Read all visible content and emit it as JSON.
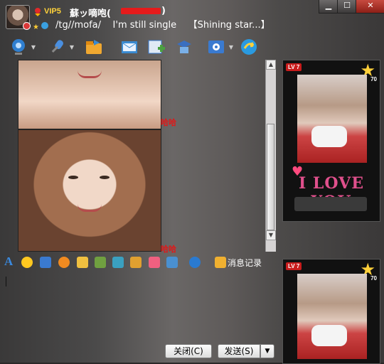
{
  "header": {
    "vip_label": "VIP5",
    "nickname_prefix": "蘇ッ嘀咆(",
    "nickname_suffix": ")",
    "signature": "/tg//mofa/    I'm still single    【Shining star...】"
  },
  "window_controls": {
    "minimize": "▁",
    "maximize": "☐",
    "close": "✕"
  },
  "toolbar": {
    "items": [
      {
        "name": "video-call",
        "icon": "webcam-icon",
        "color": "#2f7fd0"
      },
      {
        "name": "voice-call",
        "icon": "microphone-icon",
        "color": "#4a8fe0"
      },
      {
        "name": "send-file",
        "icon": "folder-icon",
        "color": "#f0a830"
      },
      {
        "name": "send-sms",
        "icon": "mail-icon",
        "color": "#3a8ad0"
      },
      {
        "name": "create-group",
        "icon": "add-group-icon",
        "color": "#4aa040"
      },
      {
        "name": "remote-assist",
        "icon": "desktop-icon",
        "color": "#3a6fc0"
      },
      {
        "name": "app-menu",
        "icon": "app-icon",
        "color": "#3a7ad0"
      },
      {
        "name": "share",
        "icon": "share-icon",
        "color": "#2a9ae0"
      }
    ]
  },
  "chat": {
    "sticker_1": "哈哈",
    "sticker_2": "哈哈"
  },
  "format_bar": {
    "font_label": "A",
    "history_label": "消息记录",
    "items": [
      {
        "icon": "smiley-icon",
        "color": "#ffc820"
      },
      {
        "icon": "magic-face-icon",
        "color": "#3a7ad0"
      },
      {
        "icon": "shake-icon",
        "color": "#f08a20"
      },
      {
        "icon": "hand-icon",
        "color": "#f0c040"
      },
      {
        "icon": "screenshot-icon",
        "color": "#70a040"
      },
      {
        "icon": "image-icon",
        "color": "#3aa0c0"
      },
      {
        "icon": "music-icon",
        "color": "#e0a030"
      },
      {
        "icon": "gift-icon",
        "color": "#f06080"
      },
      {
        "icon": "screen-icon",
        "color": "#4a90d0"
      },
      {
        "icon": "s-icon",
        "color": "#2a7ad0"
      }
    ]
  },
  "actions": {
    "close_label": "关闭(C)",
    "send_label": "发送(S)",
    "split_arrow": "▼"
  },
  "side_cards": {
    "level_label": "LV 7",
    "star_count": "70",
    "love_text": "I LOVE YOU",
    "heart": "♥"
  }
}
